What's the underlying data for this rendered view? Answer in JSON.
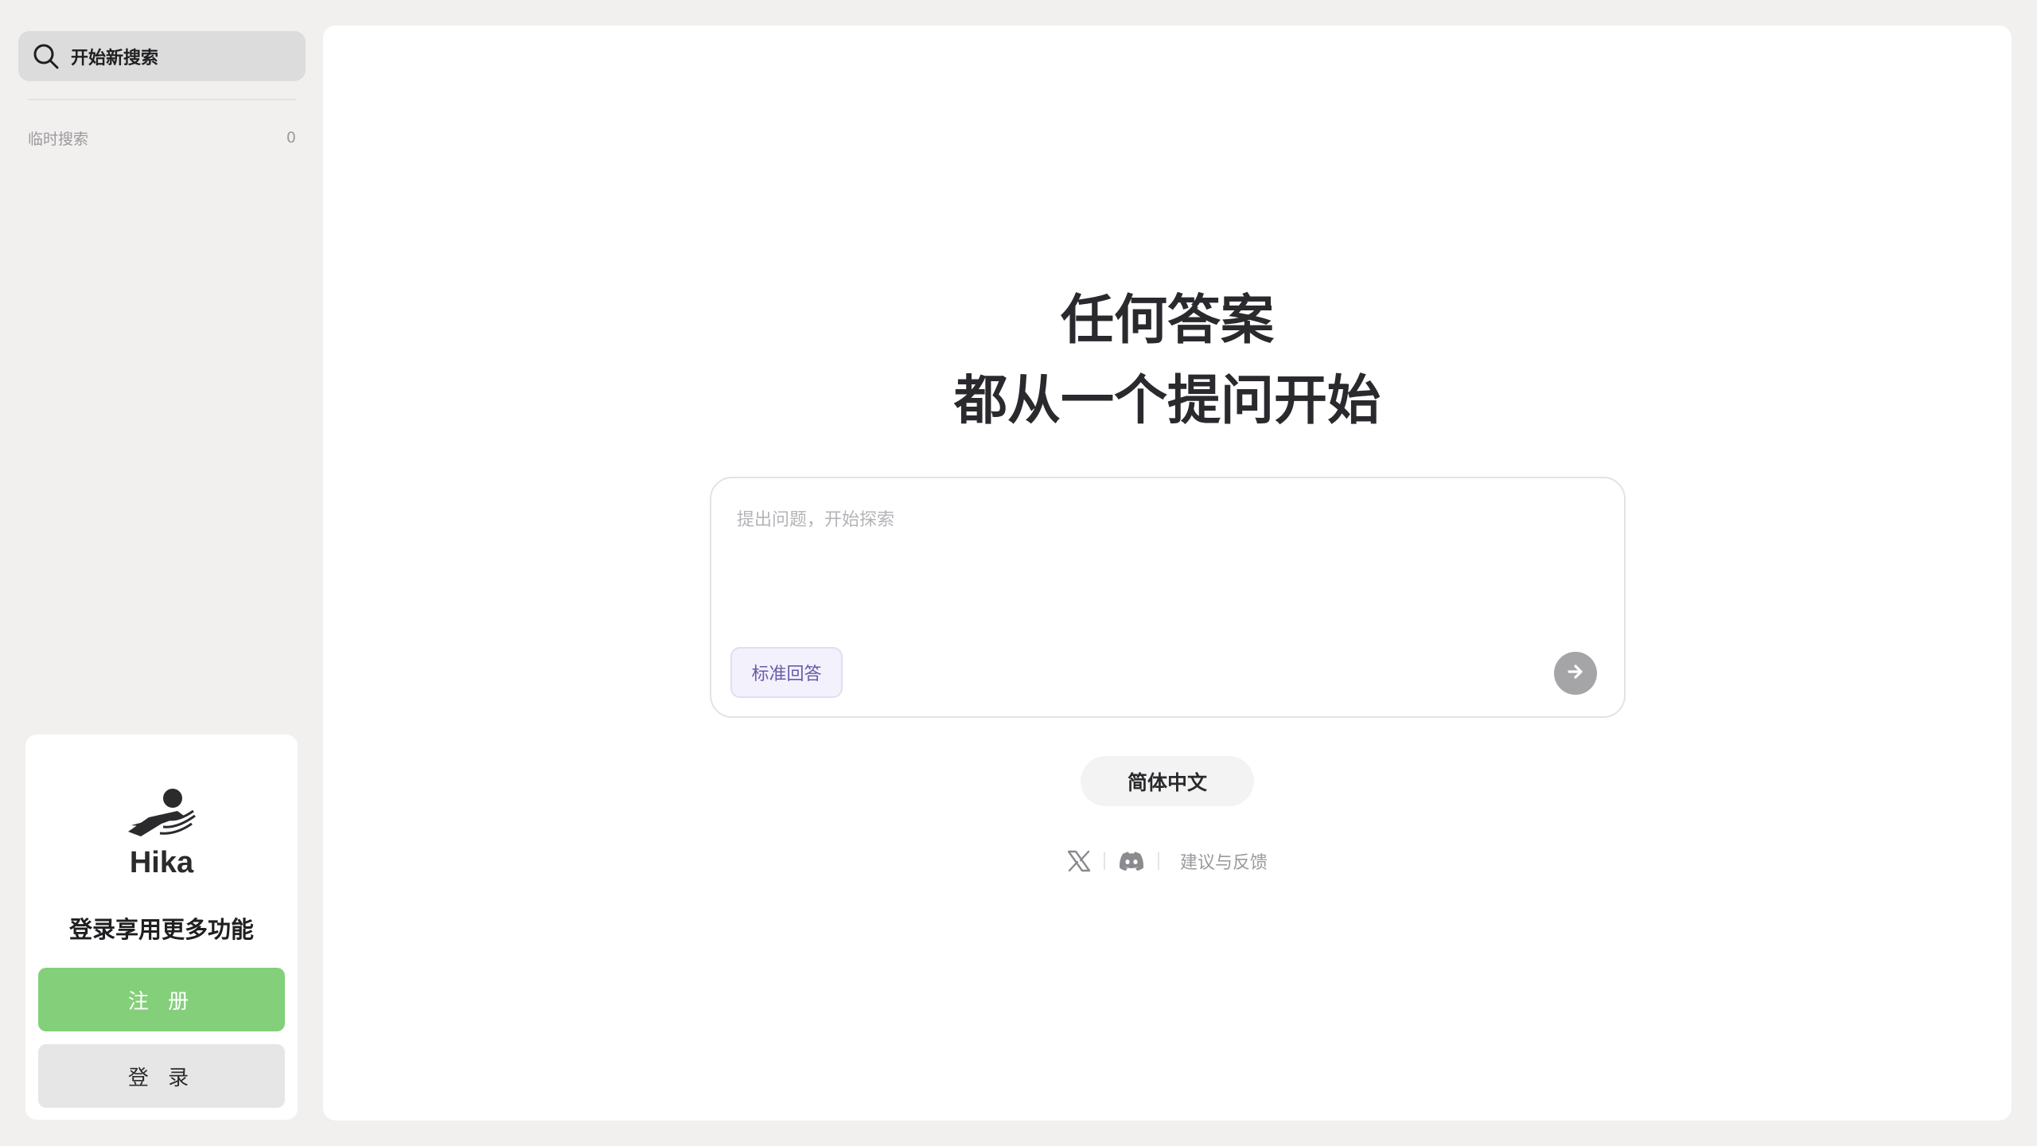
{
  "sidebar": {
    "new_search": {
      "label": "开始新搜索",
      "icon": "search-icon"
    },
    "history": {
      "label": "临时搜索",
      "count": "0"
    },
    "login_card": {
      "logo_icon": "hika-logo",
      "brand": "Hika",
      "prompt": "登录享用更多功能",
      "signup_label": "注 册",
      "login_label": "登 录"
    }
  },
  "main": {
    "hero": {
      "line1": "任何答案",
      "line2": "都从一个提问开始"
    },
    "ask": {
      "placeholder": "提出问题，开始探索",
      "mode_label": "标准回答",
      "send_icon": "arrow-right-icon"
    },
    "language_label": "简体中文",
    "footer": {
      "x_icon": "x-logo-icon",
      "discord_icon": "discord-icon",
      "feedback_label": "建议与反馈"
    }
  },
  "colors": {
    "background": "#f1f0ee",
    "signup": "#84cf7a",
    "mode_chip_text": "#6b5aa8",
    "send_button": "#a5a5a7"
  }
}
